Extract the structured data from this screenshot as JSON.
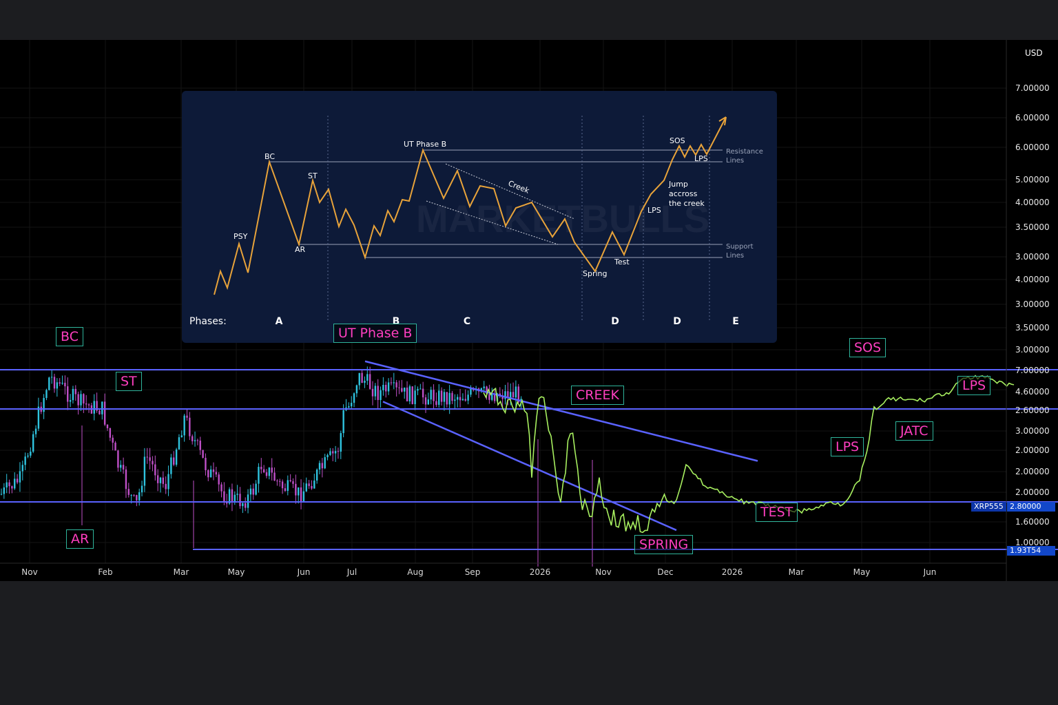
{
  "currency_label": "USD",
  "inset": {
    "phases_label": "Phases:",
    "phases": [
      "A",
      "B",
      "C",
      "D",
      "D",
      "E"
    ],
    "labels": {
      "psy": "PSY",
      "bc": "BC",
      "ar": "AR",
      "st": "ST",
      "ut": "UT Phase B",
      "creek": "Creek",
      "spring": "Spring",
      "test": "Test",
      "lps1": "LPS",
      "lps2": "LPS",
      "sos": "SOS",
      "jump1": "Jump",
      "jump2": "accross",
      "jump3": "the creek",
      "res1": "Resistance",
      "res2": "Lines",
      "sup1": "Support",
      "sup2": "Lines"
    },
    "watermark": "MARKETBULLS"
  },
  "annotations": {
    "bc": "BC",
    "st": "ST",
    "ar": "AR",
    "ut": "UT Phase B",
    "creek": "CREEK",
    "spring": "SPRING",
    "test": "TEST",
    "lps_mid": "LPS",
    "jatc": "JATC",
    "sos": "SOS",
    "lps_right": "LPS"
  },
  "price_badges": {
    "upper": "XRP555",
    "upper_value": "2.80000",
    "lower_value": "1.93T54"
  },
  "colors": {
    "background": "#000000",
    "level_line": "#5a62ff",
    "inset_bg": "#0d1a38",
    "inset_path": "#e8a33a",
    "annotation_text": "#ff3fc0",
    "annotation_border": "#2fb59c",
    "candle_up": "#2fc4e0",
    "candle_down": "#c050c8",
    "forecast_line": "#a8f060"
  },
  "chart_data": {
    "type": "line",
    "title": "",
    "x_ticks": [
      "Nov",
      "Feb",
      "Mar",
      "May",
      "Jun",
      "Jul",
      "Aug",
      "Sep",
      "2026",
      "Nov",
      "Dec",
      "2026",
      "Mar",
      "May",
      "Jun"
    ],
    "y_ticks": [
      "7.00000",
      "6.00000",
      "6.00000",
      "5.00000",
      "4.00000",
      "3.50000",
      "3.00000",
      "4.00000",
      "3.00000",
      "3.50000",
      "3.00000",
      "7.00000",
      "4.60000",
      "2.60000",
      "3.00000",
      "2.00000",
      "2.00000",
      "2.00000",
      "1.60000",
      "1.00000"
    ],
    "grid": true,
    "horizontal_levels": [
      7.0,
      2.6,
      2.0,
      1.0
    ],
    "series": [
      {
        "points": [
          [
            0,
            2.05
          ],
          [
            4,
            2.15
          ],
          [
            8,
            2.6
          ],
          [
            10,
            6.2
          ],
          [
            12,
            5.4
          ],
          [
            14,
            4.2
          ],
          [
            17,
            3.1
          ],
          [
            20,
            2.7
          ],
          [
            24,
            2.25
          ],
          [
            28,
            1.95
          ],
          [
            30,
            2.3
          ],
          [
            34,
            2.1
          ],
          [
            38,
            2.55
          ],
          [
            42,
            2.25
          ],
          [
            46,
            2.05
          ],
          [
            50,
            2.0
          ],
          [
            52,
            2.05
          ],
          [
            54,
            2.25
          ],
          [
            58,
            2.1
          ],
          [
            62,
            2.05
          ],
          [
            66,
            2.2
          ],
          [
            70,
            2.35
          ],
          [
            72,
            2.8
          ],
          [
            74,
            6.3
          ],
          [
            76,
            5.5
          ],
          [
            78,
            4.4
          ],
          [
            80,
            4.8
          ],
          [
            84,
            4.2
          ],
          [
            88,
            4.0
          ],
          [
            92,
            4.0
          ],
          [
            96,
            4.1
          ],
          [
            100,
            4.3
          ]
        ]
      },
      {
        "points": [
          [
            100,
            4.3
          ],
          [
            104,
            3.5
          ],
          [
            106,
            2.7
          ],
          [
            108,
            3.1
          ],
          [
            110,
            2.2
          ],
          [
            112,
            2.9
          ],
          [
            114,
            2.4
          ],
          [
            116,
            2.0
          ],
          [
            118,
            2.5
          ],
          [
            120,
            2.1
          ],
          [
            122,
            1.75
          ],
          [
            124,
            2.2
          ],
          [
            126,
            1.7
          ],
          [
            128,
            1.6
          ],
          [
            130,
            1.5
          ],
          [
            132,
            1.55
          ],
          [
            134,
            1.5
          ],
          [
            136,
            1.8
          ],
          [
            138,
            2.0
          ],
          [
            140,
            2.0
          ],
          [
            142,
            2.25
          ],
          [
            146,
            2.1
          ],
          [
            150,
            2.05
          ],
          [
            154,
            2.0
          ],
          [
            158,
            1.95
          ],
          [
            162,
            1.85
          ],
          [
            166,
            1.8
          ],
          [
            170,
            1.9
          ],
          [
            172,
            2.0
          ],
          [
            174,
            1.95
          ],
          [
            176,
            2.05
          ],
          [
            178,
            2.15
          ],
          [
            180,
            2.4
          ],
          [
            182,
            2.9
          ],
          [
            184,
            3.7
          ],
          [
            186,
            3.75
          ],
          [
            188,
            3.6
          ],
          [
            190,
            3.55
          ],
          [
            192,
            3.6
          ],
          [
            194,
            4.2
          ],
          [
            196,
            4.2
          ],
          [
            198,
            5.3
          ],
          [
            200,
            6.0
          ],
          [
            204,
            6.3
          ],
          [
            206,
            5.6
          ],
          [
            210,
            5.2
          ]
        ]
      }
    ],
    "trend_channel": {
      "upper": [
        [
          74,
          6.4
        ],
        [
          148,
          2.3
        ]
      ],
      "lower": [
        [
          74,
          4.5
        ],
        [
          131,
          1.55
        ]
      ]
    }
  }
}
